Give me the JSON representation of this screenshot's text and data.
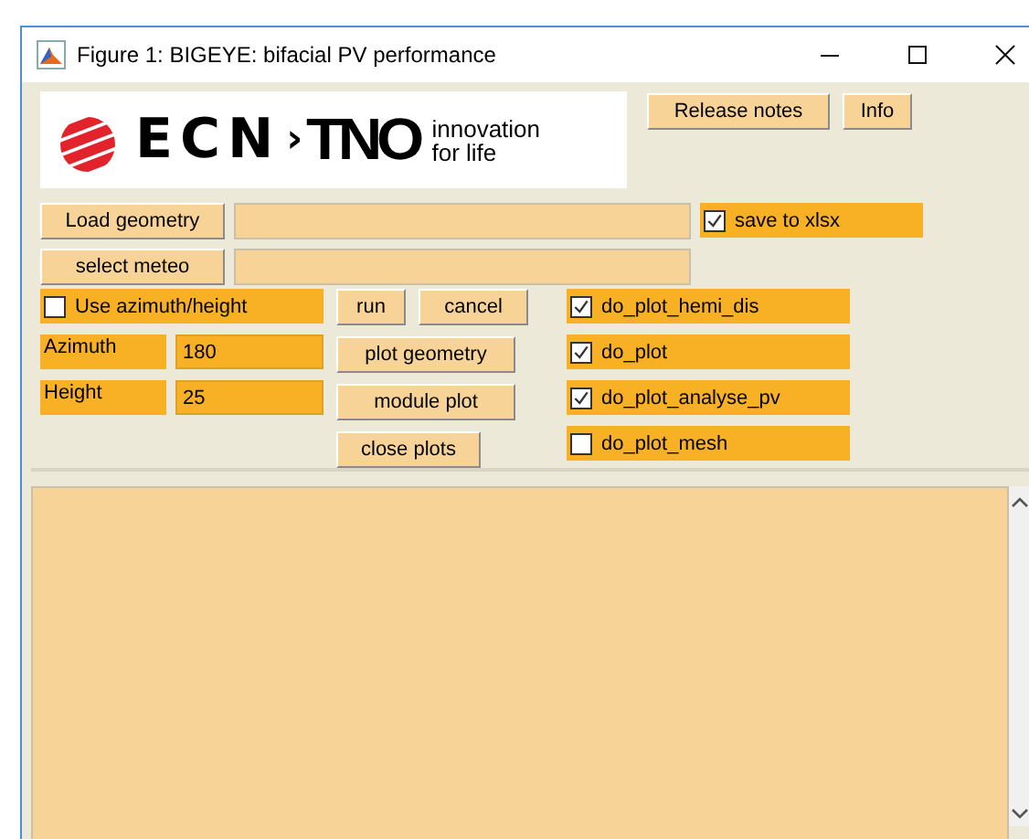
{
  "window": {
    "title": "Figure 1: BIGEYE: bifacial PV performance"
  },
  "logo": {
    "brand": "ECN",
    "separator": "›",
    "partner": "TNO",
    "tagline": [
      "innovation",
      "for life"
    ]
  },
  "top_buttons": [
    "Release notes",
    "Info"
  ],
  "file_rows": [
    {
      "button": "Load geometry",
      "value": "",
      "checkbox": {
        "label": "save to xlsx",
        "checked": true
      }
    },
    {
      "button": "select meteo",
      "value": ""
    }
  ],
  "use_azimuth": {
    "label": "Use azimuth/height",
    "checked": false
  },
  "run_buttons": [
    "run",
    "cancel"
  ],
  "fields": [
    {
      "label": "Azimuth",
      "value": "180"
    },
    {
      "label": "Height",
      "value": "25"
    }
  ],
  "plot_buttons": [
    "plot geometry",
    "module plot",
    "close plots"
  ],
  "options": [
    {
      "label": "do_plot_hemi_dis",
      "checked": true
    },
    {
      "label": "do_plot",
      "checked": true
    },
    {
      "label": "do_plot_analyse_pv",
      "checked": true
    },
    {
      "label": "do_plot_mesh",
      "checked": false
    }
  ]
}
